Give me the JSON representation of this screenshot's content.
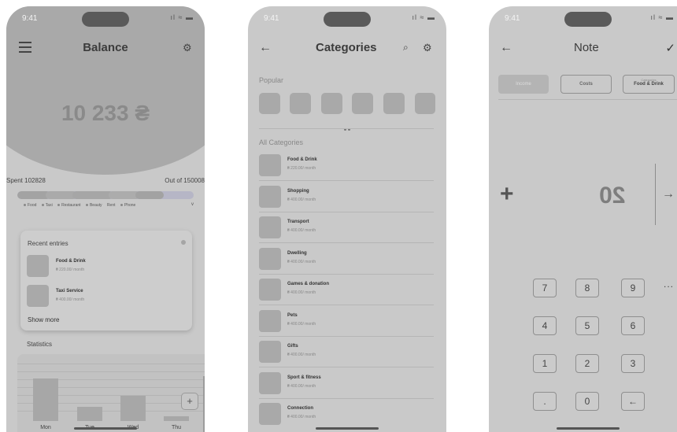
{
  "colors": {
    "screen_bg": "#c9c9c9",
    "hero": "#a9a9a9",
    "accent_lavender": "#b6b6c6"
  },
  "balance_screen": {
    "time": "9:41",
    "signal": "ıl ≈ ▬",
    "title": "Balance",
    "balance": "10 233 ₴",
    "spent": "Spent 102828",
    "out_of": "Out of 150008",
    "spent_fraction": 0.82,
    "legend": [
      "Food",
      "Taxi",
      "Restaurant",
      "Beauty",
      "Rent",
      "Phone"
    ],
    "legend_more": "v",
    "recent": {
      "header": "Recent entries",
      "entries": [
        {
          "name": "Food & Drink",
          "sub": "₴ 220.00/ month"
        },
        {
          "name": "Taxi Service",
          "sub": "₴ 400.00/ month"
        }
      ],
      "show_more": "Show more"
    },
    "statistics": {
      "label": "Statistics",
      "days": [
        "Mon",
        "Tue",
        "Wed",
        "Thu"
      ],
      "values": [
        0.75,
        0.25,
        0.45,
        0.08
      ],
      "add": "+"
    }
  },
  "categories_screen": {
    "time": "9:41",
    "signal": "ıl ≈ ▬",
    "back": "←",
    "title": "Categories",
    "search": "⌕",
    "popular_label": "Popular",
    "all_label": "All Categories",
    "items": [
      {
        "name": "Food & Drink",
        "sub": "₴ 220.00/ month"
      },
      {
        "name": "Shopping",
        "sub": "₴ 400.00/ month"
      },
      {
        "name": "Transport",
        "sub": "₴ 400.00/ month"
      },
      {
        "name": "Dwelling",
        "sub": "₴ 400.00/ month"
      },
      {
        "name": "Games & donation",
        "sub": "₴ 400.00/ month"
      },
      {
        "name": "Pets",
        "sub": "₴ 400.00/ month"
      },
      {
        "name": "Gifts",
        "sub": "₴ 400.00/ month"
      },
      {
        "name": "Sport & fitness",
        "sub": "₴ 400.00/ month"
      },
      {
        "name": "Connection",
        "sub": "₴ 400.00/ month"
      }
    ]
  },
  "note_screen": {
    "time": "9:41",
    "signal": "ıl ≈ ▬",
    "back": "←",
    "title": "Note",
    "confirm": "✓",
    "tabs": {
      "income": "Income",
      "costs": "Costs",
      "cat_label": "Categories",
      "cat_value": "Food & Drink"
    },
    "plus": "+",
    "amount": "20",
    "next": "→",
    "more": "...",
    "keys": [
      "7",
      "8",
      "9",
      "4",
      "5",
      "6",
      "1",
      "2",
      "3",
      ".",
      "0",
      "←"
    ]
  }
}
